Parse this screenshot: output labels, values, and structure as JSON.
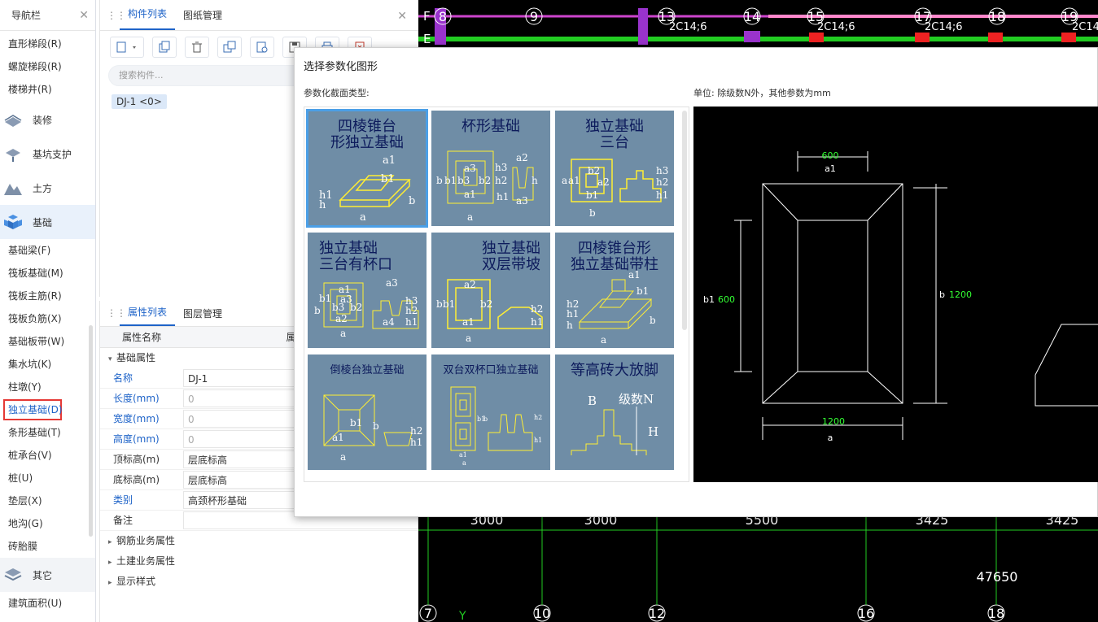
{
  "nav": {
    "title": "导航栏",
    "items_top": [
      "直形梯段(R)",
      "螺旋梯段(R)",
      "楼梯井(R)"
    ],
    "groups": {
      "decor": "装修",
      "pit": "基坑支护",
      "earth": "土方",
      "foundation": "基础",
      "other": "其它"
    },
    "items_foundation": [
      "基础梁(F)",
      "筏板基础(M)",
      "筏板主筋(R)",
      "筏板负筋(X)",
      "基础板带(W)",
      "集水坑(K)",
      "柱墩(Y)",
      "独立基础(D)",
      "条形基础(T)",
      "桩承台(V)",
      "桩(U)",
      "垫层(X)",
      "地沟(G)",
      "砖胎膜"
    ],
    "items_other": [
      "建筑面积(U)"
    ]
  },
  "component_panel": {
    "tabs": [
      "构件列表",
      "图纸管理"
    ],
    "search_placeholder": "搜索构件...",
    "item": "DJ-1 <0>"
  },
  "property_panel": {
    "tabs": [
      "属性列表",
      "图层管理"
    ],
    "col_name": "属性名称",
    "col_value": "属性值",
    "section": "基础属性",
    "rows": [
      {
        "k": "名称",
        "v": "DJ-1"
      },
      {
        "k": "长度(mm)",
        "v": "0"
      },
      {
        "k": "宽度(mm)",
        "v": "0"
      },
      {
        "k": "高度(mm)",
        "v": "0"
      },
      {
        "k": "顶标高(m)",
        "v": "层底标高"
      },
      {
        "k": "底标高(m)",
        "v": "层底标高"
      },
      {
        "k": "类别",
        "v": "高颈杯形基础"
      },
      {
        "k": "备注",
        "v": ""
      }
    ],
    "collapsed_sections": [
      "钢筋业务属性",
      "土建业务属性",
      "显示样式"
    ]
  },
  "cad": {
    "top_axes": [
      "8",
      "9",
      "13",
      "14",
      "15",
      "17",
      "18",
      "19"
    ],
    "top_labels": [
      "2C14;6",
      "2C14;6",
      "2C14;6",
      "2C14"
    ],
    "left_axes": [
      "F",
      "E"
    ],
    "dims": [
      "3000",
      "3000",
      "5500",
      "3425",
      "3425"
    ],
    "total": "47650",
    "bottom_axes": [
      "7",
      "10",
      "12",
      "16",
      "18"
    ],
    "y_marker": "Y"
  },
  "dialog": {
    "title": "选择参数化图形",
    "section_label": "参数化截面类型:",
    "unit_label": "单位:   除级数N外，其他参数为mm",
    "shapes": [
      "四棱锥台形独立基础",
      "杯形基础",
      "独立基础三台",
      "独立基础三台有杯口",
      "独立基础双层带坡",
      "四棱锥台形独立基础带柱",
      "倒棱台独立基础",
      "双台双杯口独立基础",
      "等高砖大放脚"
    ],
    "shape_title_lines": [
      [
        "四棱锥台",
        "形独立基础"
      ],
      [
        "杯形基础"
      ],
      [
        "独立基础",
        "三台"
      ],
      [
        "独立基础",
        "三台有杯口"
      ],
      [
        "独立基础",
        "双层带坡"
      ],
      [
        "四棱锥台形",
        "独立基础带柱"
      ],
      [
        "倒棱台独立基础"
      ],
      [
        "双台双杯口独立基础"
      ],
      [
        "等高砖大放脚"
      ]
    ],
    "preview": {
      "a1_value": "600",
      "a1": "a1",
      "b1_value": "600",
      "b1": "b1",
      "b_value": "1200",
      "b": "b",
      "a_value": "1200",
      "a": "a"
    }
  },
  "colors": {
    "accent": "#1e63c8",
    "cell_bg": "#6f8da6",
    "highlight": "#e53935",
    "cad_green": "#00ff00"
  }
}
